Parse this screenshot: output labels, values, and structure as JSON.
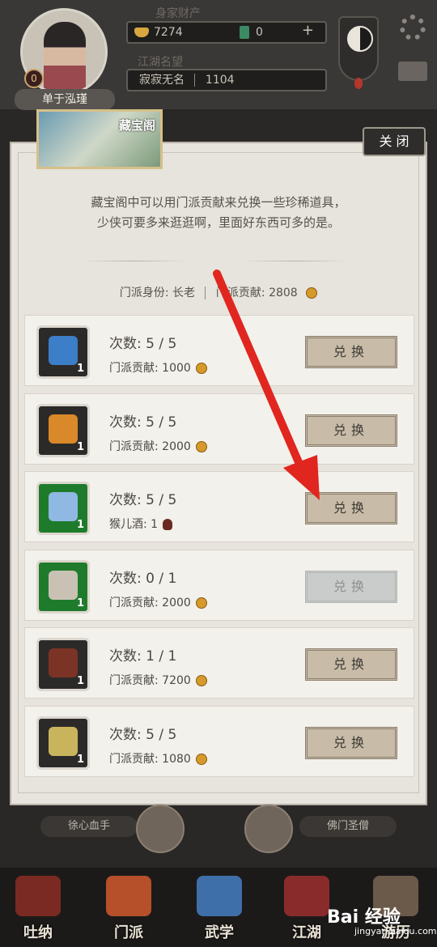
{
  "header": {
    "wealth_label": "身家财产",
    "gold_value": "7274",
    "jade_value": "0",
    "plus_symbol": "+",
    "fame_label": "江湖名望",
    "fame_title": "寂寂无名",
    "fame_value": "1104",
    "player_name": "单于泓瑾",
    "avatar_badge": "0"
  },
  "modal": {
    "banner_title": "藏宝阁",
    "close_label": "关 闭",
    "intro_line1": "藏宝阁中可以用门派贡献来兑换一些珍稀道具，",
    "intro_line2": "少侠可要多来逛逛啊，里面好东西可多的是。",
    "identity_label": "门派身份:",
    "identity_value": "长老",
    "contribution_label": "门派贡献:",
    "contribution_value": "2808"
  },
  "items": [
    {
      "count": "次数:  5 / 5",
      "cost_label": "门派贡献:",
      "cost_value": "1000",
      "qty": "1",
      "button": "兑换",
      "enabled": true,
      "rarity": "normal",
      "art_color": "#3c7ec7"
    },
    {
      "count": "次数:  5 / 5",
      "cost_label": "门派贡献:",
      "cost_value": "2000",
      "qty": "1",
      "button": "兑换",
      "enabled": true,
      "rarity": "normal",
      "art_color": "#d9882a"
    },
    {
      "count": "次数:  5 / 5",
      "cost_label": "猴儿酒:",
      "cost_value": "1",
      "qty": "1",
      "button": "兑换",
      "enabled": true,
      "rarity": "green",
      "art_color": "#8fb8e2"
    },
    {
      "count": "次数:  0 / 1",
      "cost_label": "门派贡献:",
      "cost_value": "2000",
      "qty": "1",
      "button": "兑换",
      "enabled": false,
      "rarity": "green",
      "art_color": "#c9c2b4"
    },
    {
      "count": "次数:  1 / 1",
      "cost_label": "门派贡献:",
      "cost_value": "7200",
      "qty": "1",
      "button": "兑换",
      "enabled": true,
      "rarity": "normal",
      "art_color": "#7b3326"
    },
    {
      "count": "次数:  5 / 5",
      "cost_label": "门派贡献:",
      "cost_value": "1080",
      "qty": "1",
      "button": "兑换",
      "enabled": true,
      "rarity": "normal",
      "art_color": "#c9b45e"
    }
  ],
  "skills": {
    "left_label": "徐心血手",
    "right_label": "佛门圣僧"
  },
  "nav": [
    {
      "label": "吐纳",
      "art_color": "#7a2a22"
    },
    {
      "label": "门派",
      "art_color": "#b5502a"
    },
    {
      "label": "武学",
      "art_color": "#3f6fa8"
    },
    {
      "label": "江湖",
      "art_color": "#8a2b2b"
    },
    {
      "label": "游历",
      "art_color": "#6b5a4a"
    }
  ],
  "watermark": {
    "brand": "Bai 经验",
    "url": "jingyan.baidu.com"
  },
  "colors": {
    "annotation_arrow": "#e0261f",
    "panel_bg": "#e7e3dd",
    "button_bg": "#c8bca8"
  }
}
